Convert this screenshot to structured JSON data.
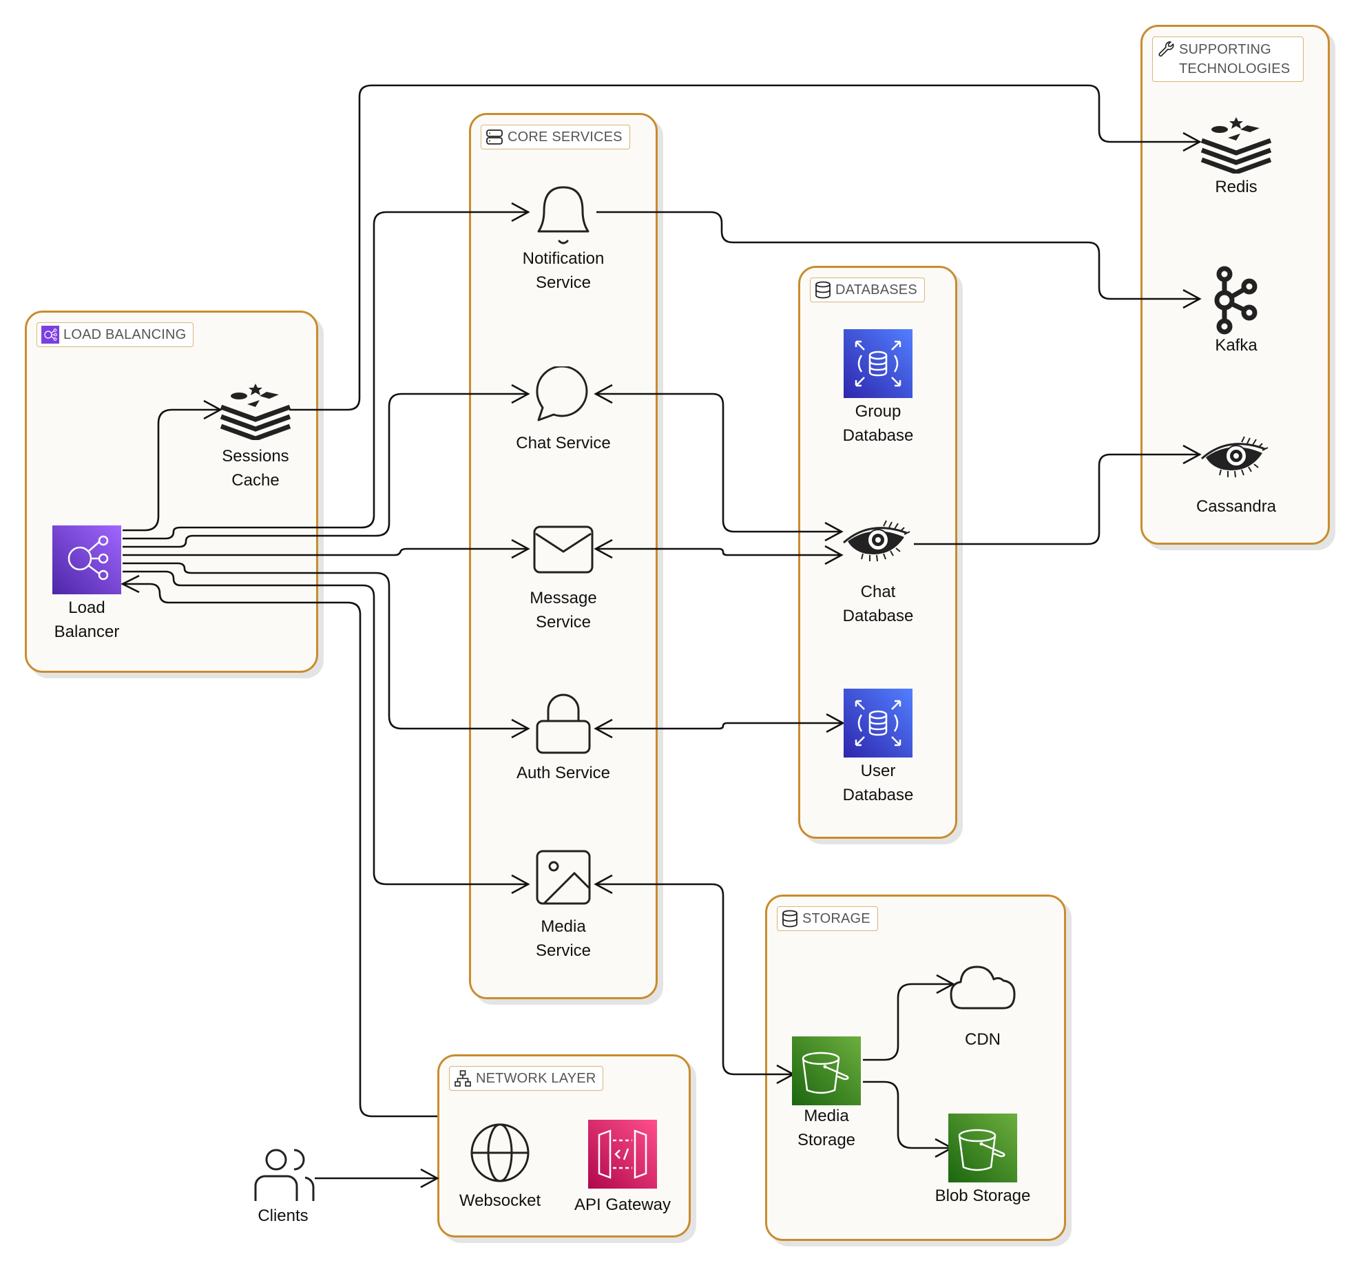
{
  "groups": {
    "load_balancing": {
      "title": "LOAD BALANCING",
      "icon": "load-balancer-icon"
    },
    "core_services": {
      "title": "CORE SERVICES",
      "icon": "server-stack-icon"
    },
    "databases": {
      "title": "DATABASES",
      "icon": "database-icon"
    },
    "supporting": {
      "title": "SUPPORTING TECHNOLOGIES",
      "icon": "wrench-icon"
    },
    "network": {
      "title": "NETWORK LAYER",
      "icon": "network-tree-icon"
    },
    "storage": {
      "title": "STORAGE",
      "icon": "database-icon"
    }
  },
  "nodes": {
    "sessions_cache": {
      "label": "Sessions\nCache",
      "icon": "redis-icon"
    },
    "load_balancer": {
      "label": "Load\nBalancer",
      "icon": "elb-icon"
    },
    "notification_service": {
      "label": "Notification\nService",
      "icon": "bell-icon"
    },
    "chat_service": {
      "label": "Chat Service",
      "icon": "chat-bubble-icon"
    },
    "message_service": {
      "label": "Message\nService",
      "icon": "envelope-icon"
    },
    "auth_service": {
      "label": "Auth Service",
      "icon": "lock-icon"
    },
    "media_service": {
      "label": "Media\nService",
      "icon": "image-icon"
    },
    "group_database": {
      "label": "Group\nDatabase",
      "icon": "rds-icon"
    },
    "chat_database": {
      "label": "Chat\nDatabase",
      "icon": "cassandra-eye-icon"
    },
    "user_database": {
      "label": "User\nDatabase",
      "icon": "rds-icon"
    },
    "redis": {
      "label": "Redis",
      "icon": "redis-icon"
    },
    "kafka": {
      "label": "Kafka",
      "icon": "kafka-icon"
    },
    "cassandra": {
      "label": "Cassandra",
      "icon": "cassandra-eye-icon"
    },
    "websocket": {
      "label": "Websocket",
      "icon": "globe-icon"
    },
    "api_gateway": {
      "label": "API Gateway",
      "icon": "api-gateway-icon"
    },
    "clients": {
      "label": "Clients",
      "icon": "users-icon"
    },
    "media_storage": {
      "label": "Media\nStorage",
      "icon": "s3-bucket-icon"
    },
    "cdn": {
      "label": "CDN",
      "icon": "cloud-icon"
    },
    "blob_storage": {
      "label": "Blob Storage",
      "icon": "s3-bucket-icon"
    }
  },
  "colors": {
    "group_border": "#c98c2e",
    "group_fill": "#fbfaf6",
    "elb_purple": "#7b3fe0",
    "rds_blue": "#3b48cc",
    "s3_green": "#3f8624",
    "api_gateway_pink": "#d6246e"
  },
  "edges": [
    {
      "from": "load_balancer",
      "to": "sessions_cache"
    },
    {
      "from": "sessions_cache",
      "to": "redis"
    },
    {
      "from": "load_balancer",
      "to": "notification_service"
    },
    {
      "from": "load_balancer",
      "to": "chat_service"
    },
    {
      "from": "load_balancer",
      "to": "message_service"
    },
    {
      "from": "load_balancer",
      "to": "auth_service"
    },
    {
      "from": "load_balancer",
      "to": "media_service"
    },
    {
      "from": "websocket",
      "to": "load_balancer"
    },
    {
      "from": "notification_service",
      "to": "kafka"
    },
    {
      "from": "chat_database",
      "to": "chat_service"
    },
    {
      "from": "chat_service",
      "to": "chat_database"
    },
    {
      "from": "message_service",
      "to": "chat_database"
    },
    {
      "from": "chat_database",
      "to": "message_service"
    },
    {
      "from": "chat_database",
      "to": "cassandra"
    },
    {
      "from": "auth_service",
      "to": "user_database"
    },
    {
      "from": "user_database",
      "to": "auth_service"
    },
    {
      "from": "media_service",
      "to": "media_storage"
    },
    {
      "from": "media_storage",
      "to": "media_service"
    },
    {
      "from": "media_storage",
      "to": "cdn"
    },
    {
      "from": "media_storage",
      "to": "blob_storage"
    },
    {
      "from": "clients",
      "to": "websocket"
    }
  ]
}
